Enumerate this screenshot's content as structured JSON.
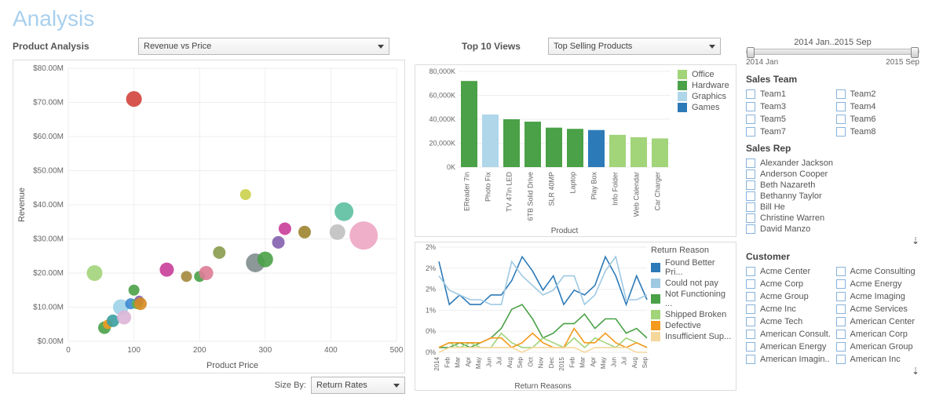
{
  "page_title": "Analysis",
  "left": {
    "label": "Product Analysis",
    "select": "Revenue vs Price",
    "yaxis": "Revenue",
    "xaxis": "Product Price",
    "sizeby_label": "Size By:",
    "sizeby_value": "Return Rates"
  },
  "mid": {
    "top_label": "Top 10 Views",
    "top_select": "Top Selling Products",
    "bar_xaxis": "Product",
    "line_title": "Return Reasons",
    "line_legend_title": "Return Reason"
  },
  "right": {
    "time_label": "2014 Jan..2015 Sep",
    "time_start": "2014 Jan",
    "time_end": "2015 Sep",
    "sales_team_title": "Sales Team",
    "sales_rep_title": "Sales Rep",
    "customer_title": "Customer"
  },
  "chart_data": [
    {
      "id": "scatter",
      "type": "scatter",
      "xlabel": "Product Price",
      "ylabel": "Revenue",
      "xlim": [
        0,
        500
      ],
      "ylim": [
        0,
        80
      ],
      "yticks": [
        "$0.00M",
        "$10.00M",
        "$20.00M",
        "$30.00M",
        "$40.00M",
        "$50.00M",
        "$60.00M",
        "$70.00M",
        "$80.00M"
      ],
      "xticks": [
        0,
        100,
        200,
        300,
        400,
        500
      ],
      "points": [
        {
          "x": 40,
          "y": 20,
          "r": 10,
          "c": "#a2d47a"
        },
        {
          "x": 55,
          "y": 4,
          "r": 8,
          "c": "#4aa147"
        },
        {
          "x": 60,
          "y": 5,
          "r": 6,
          "c": "#f39a1f"
        },
        {
          "x": 68,
          "y": 6,
          "r": 8,
          "c": "#3aa0a0"
        },
        {
          "x": 80,
          "y": 10,
          "r": 10,
          "c": "#9ed1e8"
        },
        {
          "x": 85,
          "y": 7,
          "r": 9,
          "c": "#dcb6d6"
        },
        {
          "x": 95,
          "y": 11,
          "r": 7,
          "c": "#3c8ad1"
        },
        {
          "x": 100,
          "y": 15,
          "r": 7,
          "c": "#4aa147"
        },
        {
          "x": 100,
          "y": 71,
          "r": 10,
          "c": "#d1423b"
        },
        {
          "x": 105,
          "y": 11,
          "r": 7,
          "c": "#5ab04f"
        },
        {
          "x": 108,
          "y": 12,
          "r": 6,
          "c": "#835fae"
        },
        {
          "x": 110,
          "y": 11,
          "r": 8,
          "c": "#d68c24"
        },
        {
          "x": 150,
          "y": 21,
          "r": 9,
          "c": "#c93d98"
        },
        {
          "x": 180,
          "y": 19,
          "r": 7,
          "c": "#a3883d"
        },
        {
          "x": 200,
          "y": 19,
          "r": 7,
          "c": "#4aa147"
        },
        {
          "x": 210,
          "y": 20,
          "r": 9,
          "c": "#dd7c93"
        },
        {
          "x": 230,
          "y": 26,
          "r": 8,
          "c": "#889b4c"
        },
        {
          "x": 270,
          "y": 43,
          "r": 7,
          "c": "#cbd04a"
        },
        {
          "x": 285,
          "y": 23,
          "r": 12,
          "c": "#7f8c8d"
        },
        {
          "x": 300,
          "y": 24,
          "r": 10,
          "c": "#4aa147"
        },
        {
          "x": 320,
          "y": 29,
          "r": 8,
          "c": "#835fae"
        },
        {
          "x": 330,
          "y": 33,
          "r": 8,
          "c": "#c93d98"
        },
        {
          "x": 360,
          "y": 32,
          "r": 8,
          "c": "#9d8430"
        },
        {
          "x": 410,
          "y": 32,
          "r": 10,
          "c": "#c0c0c0"
        },
        {
          "x": 420,
          "y": 38,
          "r": 12,
          "c": "#5cbfa0"
        },
        {
          "x": 450,
          "y": 31,
          "r": 18,
          "c": "#eea6c3"
        }
      ]
    },
    {
      "id": "bars",
      "type": "bar",
      "categories": [
        "EReader 7in",
        "Photo Fix",
        "TV 47in LED",
        "6TB Solid Drive",
        "SLR 40MP",
        "Laptop",
        "Play Box",
        "Info Folder",
        "Web Calendar",
        "Car Charger"
      ],
      "values": [
        72000,
        44000,
        40000,
        38000,
        33000,
        32000,
        31000,
        27000,
        25000,
        24000
      ],
      "colors": [
        "#4aa147",
        "#b0d6ea",
        "#4aa147",
        "#4aa147",
        "#4aa147",
        "#4aa147",
        "#2d7ab8",
        "#a2d47a",
        "#a2d47a",
        "#a2d47a"
      ],
      "ylim": [
        0,
        80000
      ],
      "yticks": [
        "0K",
        "20,000K",
        "40,000K",
        "60,000K",
        "80,000K"
      ],
      "legend": [
        {
          "label": "Office",
          "color": "#a2d47a"
        },
        {
          "label": "Hardware",
          "color": "#4aa147"
        },
        {
          "label": "Graphics",
          "color": "#b0d6ea"
        },
        {
          "label": "Games",
          "color": "#2d7ab8"
        }
      ],
      "xlabel": "Product"
    },
    {
      "id": "lines",
      "type": "line",
      "x": [
        "2014",
        "Feb",
        "Mar",
        "Apr",
        "May",
        "Jun",
        "Jul",
        "Aug",
        "Sep",
        "Oct",
        "Nov",
        "Dec",
        "2015",
        "Feb",
        "Mar",
        "Apr",
        "May",
        "Jun",
        "Jul",
        "Aug",
        "Sep"
      ],
      "ylim": [
        0,
        2.2
      ],
      "yticks": [
        "0%",
        "0%",
        "1%",
        "2%",
        "2%",
        "2%"
      ],
      "series": [
        {
          "name": "Found Better Pri...",
          "color": "#2d7ab8",
          "values": [
            1.9,
            1.0,
            1.2,
            1.0,
            1.0,
            1.2,
            1.2,
            1.5,
            2.0,
            1.7,
            1.3,
            1.6,
            1.0,
            1.3,
            1.2,
            1.4,
            2.0,
            1.6,
            1.0,
            1.6,
            1.1
          ]
        },
        {
          "name": "Could not pay",
          "color": "#9fc9e3",
          "values": [
            1.6,
            1.3,
            1.2,
            1.1,
            1.1,
            1.0,
            1.0,
            1.9,
            1.6,
            1.4,
            1.2,
            1.3,
            1.6,
            1.6,
            1.0,
            1.2,
            1.7,
            2.0,
            1.1,
            1.1,
            1.2
          ]
        },
        {
          "name": "Not Functioning ...",
          "color": "#4aa147",
          "values": [
            0.1,
            0.1,
            0.2,
            0.1,
            0.2,
            0.3,
            0.5,
            0.9,
            1.0,
            0.7,
            0.3,
            0.4,
            0.6,
            0.6,
            0.8,
            0.5,
            0.7,
            0.7,
            0.4,
            0.5,
            0.3
          ]
        },
        {
          "name": "Shipped Broken",
          "color": "#a2d47a",
          "values": [
            0.1,
            0.2,
            0.1,
            0.2,
            0.1,
            0.1,
            0.4,
            0.2,
            0.1,
            0.1,
            0.3,
            0.2,
            0.1,
            0.3,
            0.1,
            0.3,
            0.2,
            0.1,
            0.3,
            0.2,
            0.1
          ]
        },
        {
          "name": "Defective",
          "color": "#f39a1f",
          "values": [
            0.1,
            0.2,
            0.2,
            0.2,
            0.2,
            0.3,
            0.3,
            0.1,
            0.2,
            0.4,
            0.2,
            0.1,
            0.1,
            0.5,
            0.2,
            0.2,
            0.4,
            0.2,
            0.1,
            0.2,
            0.1
          ]
        },
        {
          "name": "Insufficient Sup...",
          "color": "#f5d79c",
          "values": [
            0.0,
            0.1,
            0.1,
            0.1,
            0.1,
            0.1,
            0.1,
            0.1,
            0.0,
            0.1,
            0.1,
            0.1,
            0.1,
            0.1,
            0.0,
            0.1,
            0.1,
            0.1,
            0.1,
            0.0,
            0.0
          ]
        }
      ]
    }
  ],
  "filters": {
    "teams": [
      "Team1",
      "Team2",
      "Team3",
      "Team4",
      "Team5",
      "Team6",
      "Team7",
      "Team8"
    ],
    "reps": [
      "Alexander Jackson",
      "Anderson Cooper",
      "Beth Nazareth",
      "Bethanny Taylor",
      "Bill He",
      "Christine Warren",
      "David Manzo"
    ],
    "customers": [
      "Acme Center",
      "Acme Consulting",
      "Acme Corp",
      "Acme Energy",
      "Acme Group",
      "Acme Imaging",
      "Acme Inc",
      "Acme Services",
      "Acme Tech",
      "American Center",
      "American Consult...",
      "American Corp",
      "American Energy",
      "American Group",
      "American Imagin...",
      "American Inc"
    ]
  }
}
